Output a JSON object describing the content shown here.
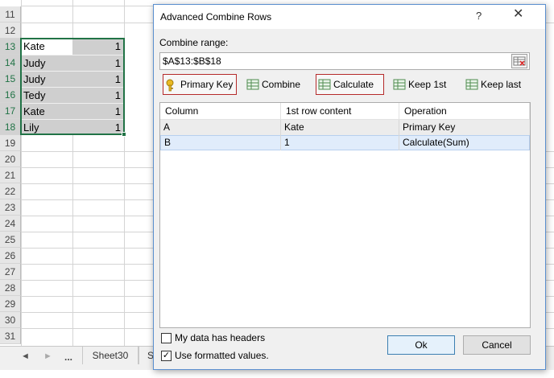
{
  "sheet": {
    "row_numbers": [
      "11",
      "12",
      "13",
      "14",
      "15",
      "16",
      "17",
      "18",
      "19",
      "20",
      "21",
      "22",
      "23",
      "24",
      "25",
      "26",
      "27",
      "28",
      "29",
      "30",
      "31"
    ],
    "rows": [
      {
        "a": "Kate",
        "b": "1"
      },
      {
        "a": "Judy",
        "b": "1"
      },
      {
        "a": "Judy",
        "b": "1"
      },
      {
        "a": "Tedy",
        "b": "1"
      },
      {
        "a": "Kate",
        "b": "1"
      },
      {
        "a": "Lily",
        "b": "1"
      }
    ],
    "tabs": {
      "nav_prev": "◄",
      "nav_next": "►",
      "ellipsis": "...",
      "sheet_name": "Sheet30",
      "partial_tab": "S"
    }
  },
  "dialog": {
    "title": "Advanced Combine Rows",
    "help": "?",
    "close": "✕",
    "range_label": "Combine range:",
    "range_value": "$A$13:$B$18",
    "toolbar": {
      "primary_key": "Primary Key",
      "combine": "Combine",
      "calculate": "Calculate",
      "keep_first": "Keep 1st",
      "keep_last": "Keep last"
    },
    "table": {
      "headers": [
        "Column",
        "1st row content",
        "Operation"
      ],
      "rows": [
        [
          "A",
          "Kate",
          "Primary Key"
        ],
        [
          "B",
          "1",
          "Calculate(Sum)"
        ]
      ]
    },
    "options": {
      "has_headers": "My data has headers",
      "formatted_values": "Use formatted values."
    },
    "buttons": {
      "ok": "Ok",
      "cancel": "Cancel"
    }
  },
  "colors": {
    "excel_green": "#217346",
    "highlight_red": "#b52a2a",
    "selected_row": "#e0ecfb"
  }
}
